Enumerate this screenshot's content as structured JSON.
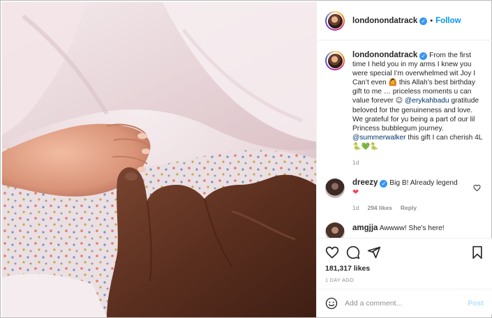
{
  "post": {
    "username": "londonondatrack",
    "verified": true,
    "follow_label": "Follow",
    "separator": "•"
  },
  "caption": {
    "username": "londonondatrack",
    "text_1": "From the first time I held you in my arms I knew you were special I’m overwhelmed wit Joy I Can’t even ",
    "emoji_1": "🙆",
    "text_2": " this Allah’s best birthday gift to me … priceless moments u can value forever ",
    "emoji_2": "☺",
    "mention_1": "@erykahbadu",
    "text_3": " gratitude beloved for the genuineness and love. We grateful for yu being a part of our lil Princess bubblegum journey. ",
    "mention_2": "@summerwalker",
    "text_4": " this gift I can cherish 4L ",
    "emoji_3": "🐍💚🐍",
    "age": "1d"
  },
  "comments": [
    {
      "username": "dreezy",
      "verified": true,
      "text": "Big B! Already legend",
      "emoji": "❤",
      "age": "1d",
      "likes": "294 likes",
      "reply_label": "Reply"
    },
    {
      "username": "amgjja",
      "text": "Awwww! She's here!"
    }
  ],
  "actions": {
    "likes_count": "181,317 likes",
    "timestamp": "1 DAY AGO",
    "comment_placeholder": "Add a comment...",
    "post_label": "Post"
  },
  "icons": {
    "like": "heart-icon",
    "comment": "comment-icon",
    "share": "share-icon",
    "save": "bookmark-icon",
    "emoji": "smiley-icon",
    "comment_like": "small-heart-icon"
  },
  "colors": {
    "accent": "#0095f6",
    "verified": "#3897f0",
    "mention": "#00376b",
    "muted": "#8e8e8e",
    "post_disabled": "#b2dffc",
    "heart": "#ed4956"
  }
}
